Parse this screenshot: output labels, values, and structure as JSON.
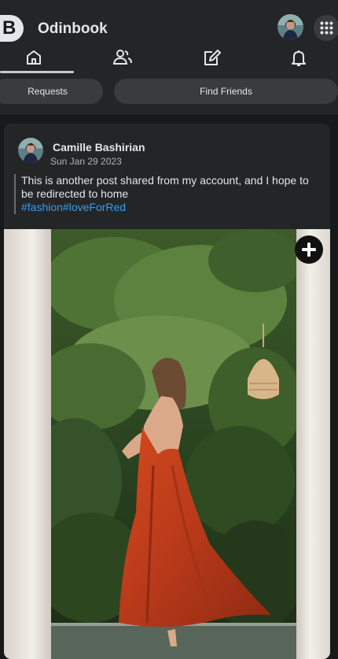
{
  "app": {
    "logo_letter": "B",
    "title": "Odinbook"
  },
  "nav": {
    "tabs": [
      {
        "icon": "home-icon",
        "active": true
      },
      {
        "icon": "friends-icon",
        "active": false
      },
      {
        "icon": "edit-icon",
        "active": false
      },
      {
        "icon": "bell-icon",
        "active": false
      }
    ]
  },
  "subnav": {
    "requests_label": "Requests",
    "find_friends_label": "Find Friends"
  },
  "post": {
    "author": "Camille Bashirian",
    "date": "Sun Jan 29 2023",
    "text": "This is another post shared from my account, and I hope to be redirected to home",
    "hashtags": "#fashion#loveForRed"
  },
  "colors": {
    "background": "#18191a",
    "surface": "#242526",
    "pill": "#3a3b3c",
    "text": "#e4e6eb",
    "muted": "#b0b3b8",
    "hashtag": "#3b9be8",
    "dress": "#c0401c"
  }
}
